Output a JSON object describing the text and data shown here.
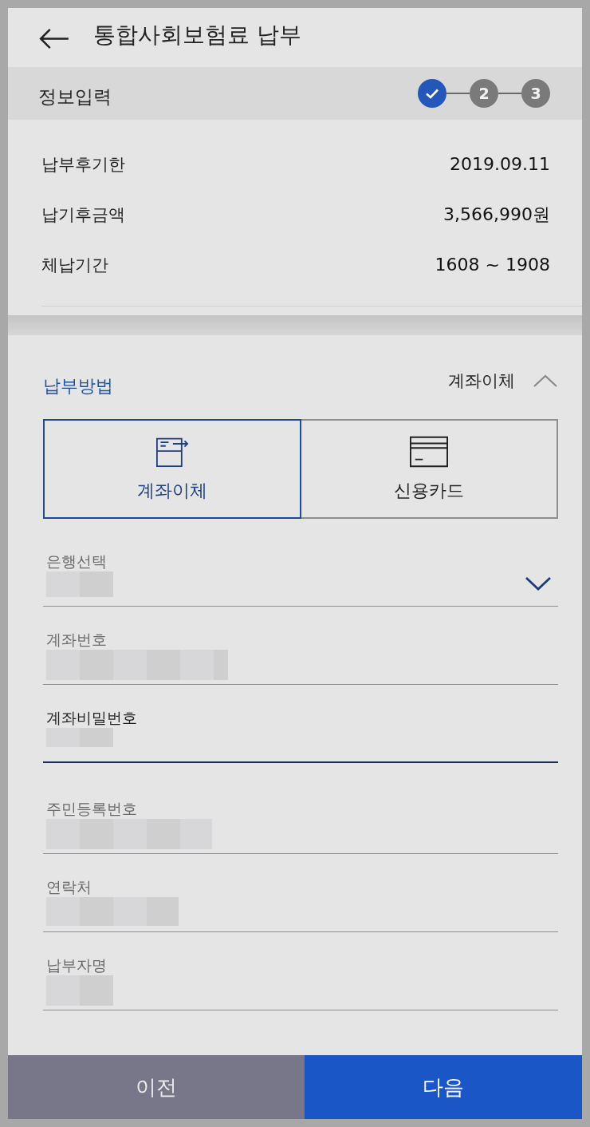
{
  "header": {
    "title": "통합사회보험료 납부"
  },
  "step_bar": {
    "title": "정보입력",
    "steps": [
      {
        "completed": true
      },
      {
        "number": "2",
        "completed": false
      },
      {
        "number": "3",
        "completed": false
      }
    ]
  },
  "details": [
    {
      "label": "납부후기한",
      "value": "2019.09.11"
    },
    {
      "label": "납기후금액",
      "value": "3,566,990원"
    },
    {
      "label": "체납기간",
      "value": "1608 ~ 1908"
    }
  ],
  "payment_method": {
    "title": "납부방법",
    "summary": "계좌이체",
    "expanded": true,
    "options": [
      {
        "kind": "transfer",
        "label": "계좌이체",
        "selected": true
      },
      {
        "kind": "card",
        "label": "신용카드",
        "selected": false
      }
    ]
  },
  "fields": [
    {
      "kind": "select",
      "label": "은행선택",
      "redacted": true,
      "focused": false
    },
    {
      "kind": "text",
      "label": "계좌번호",
      "redacted": true,
      "focused": false
    },
    {
      "kind": "text",
      "label": "계좌비밀번호",
      "redacted": true,
      "focused": true
    },
    {
      "kind": "text",
      "label": "주민등록번호",
      "redacted": true,
      "focused": false
    },
    {
      "kind": "text",
      "label": "연락처",
      "redacted": true,
      "focused": false
    },
    {
      "kind": "text",
      "label": "납부자명",
      "redacted": true,
      "focused": false
    }
  ],
  "buttons": [
    {
      "kind": "secondary",
      "label": "이전"
    },
    {
      "kind": "primary",
      "label": "다음"
    }
  ]
}
